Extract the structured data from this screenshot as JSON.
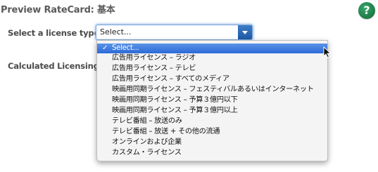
{
  "header": {
    "title": "Preview RateCard: 基本",
    "help_symbol": "?"
  },
  "form": {
    "license_type_label": "Select a license type:",
    "calculated_label": "Calculated Licensing",
    "select_value": "Select..."
  },
  "dropdown": {
    "check_mark": "✓",
    "items": [
      {
        "label": "Select...",
        "selected": true
      },
      {
        "label": "広告用ライセンス – ラジオ"
      },
      {
        "label": "広告用ライセンス – テレビ"
      },
      {
        "label": "広告用ライセンス – すべてのメディア"
      },
      {
        "label": "映画用同期ライセンス – フェスティバルあるいはインターネット"
      },
      {
        "label": "映画用同期ライセンス – 予算３億円以下"
      },
      {
        "label": "映画用同期ライセンス – 予算３億円以上"
      },
      {
        "label": "テレビ番組 – 放送のみ"
      },
      {
        "label": "テレビ番組 – 放送 + その他の流通"
      },
      {
        "label": "オンラインおよび企業"
      },
      {
        "label": "カスタム・ライセンス"
      }
    ]
  },
  "colors": {
    "highlight": "#2c6ad9",
    "help_icon": "#1d7a45",
    "focus_ring": "#8fb6e6"
  }
}
